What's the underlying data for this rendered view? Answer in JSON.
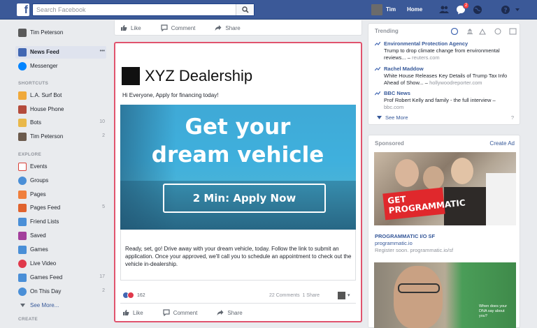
{
  "topbar": {
    "logo": "f",
    "search_placeholder": "Search Facebook",
    "user_name": "Tim",
    "home_label": "Home",
    "notification_count": "2",
    "icons": [
      "friend-requests-icon",
      "messages-icon",
      "notifications-icon",
      "help-icon",
      "chevron-down-icon"
    ],
    "bar_color": "#3b5998"
  },
  "left_nav": {
    "profile_name": "Tim Peterson",
    "main": [
      {
        "label": "News Feed",
        "icon": "news-feed-icon",
        "more": "•••"
      },
      {
        "label": "Messenger",
        "icon": "messenger-icon"
      }
    ],
    "shortcuts_title": "SHORTCUTS",
    "shortcuts": [
      {
        "label": "L.A. Surf Bot",
        "icon": "surf-bot-icon",
        "count": ""
      },
      {
        "label": "House Phone",
        "icon": "house-phone-icon",
        "count": ""
      },
      {
        "label": "Bots",
        "icon": "bots-icon",
        "count": "10"
      },
      {
        "label": "Tim Peterson",
        "icon": "profile-icon",
        "count": "2"
      }
    ],
    "explore_title": "EXPLORE",
    "explore": [
      {
        "label": "Events",
        "icon": "events-icon",
        "count": ""
      },
      {
        "label": "Groups",
        "icon": "groups-icon",
        "count": ""
      },
      {
        "label": "Pages",
        "icon": "pages-icon",
        "count": ""
      },
      {
        "label": "Pages Feed",
        "icon": "pages-feed-icon",
        "count": "5"
      },
      {
        "label": "Friend Lists",
        "icon": "friend-lists-icon",
        "count": ""
      },
      {
        "label": "Saved",
        "icon": "saved-icon",
        "count": ""
      },
      {
        "label": "Games",
        "icon": "games-icon",
        "count": ""
      },
      {
        "label": "Live Video",
        "icon": "live-video-icon",
        "count": ""
      },
      {
        "label": "Games Feed",
        "icon": "games-feed-icon",
        "count": "17"
      },
      {
        "label": "On This Day",
        "icon": "on-this-day-icon",
        "count": "2"
      }
    ],
    "see_more": "See More...",
    "create_title": "CREATE"
  },
  "feed": {
    "top_actions": {
      "like": "Like",
      "comment": "Comment",
      "share": "Share"
    },
    "post": {
      "brand": "XYZ Dealership",
      "intro": "Hi Everyone, Apply for financing today!",
      "hero_line1": "Get your",
      "hero_line2": "dream vehicle",
      "cta": "2 Min: Apply Now",
      "description": "Ready, set, go! Drive away with your dream vehicle, today. Follow the link to submit an application. Once your approved, we'll call you to schedule an appointment to check out the vehicle in-dealership.",
      "reaction_count": "162",
      "comments": "22 Comments",
      "shares": "1 Share",
      "actions": {
        "like": "Like",
        "comment": "Comment",
        "share": "Share"
      },
      "highlight_color": "#e0536d"
    }
  },
  "trending": {
    "title": "Trending",
    "items": [
      {
        "name": "Environmental Protection Agency",
        "text": "Trump to drop climate change from environmental reviews...",
        "source": "reuters.com"
      },
      {
        "name": "Rachel Maddow",
        "text": "White House Releases Key Details of Trump Tax Info Ahead of Show...",
        "source": "hollywoodreporter.com"
      },
      {
        "name": "BBC News",
        "text": "Prof Robert Kelly and family - the full interview",
        "source": "bbc.com"
      }
    ],
    "see_more": "See More",
    "help": "?"
  },
  "sponsored": {
    "title": "Sponsored",
    "create_ad": "Create Ad",
    "ad_badge": "GET PROGRAMMATIC",
    "ad_heading": "PROGRAMMATIC I/O SF",
    "ad_site": "programmatic.io",
    "ad_register": "Register soon. programmatic.io/sf",
    "ad2_text": "When does your DNA say about you?"
  }
}
